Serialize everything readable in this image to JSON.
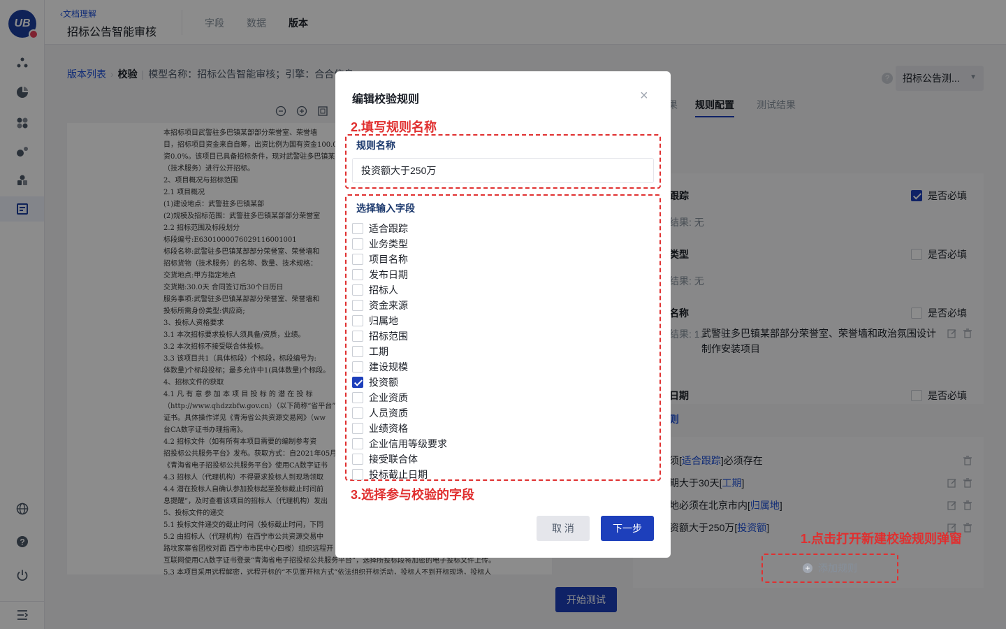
{
  "logo": {
    "text": "UB"
  },
  "header": {
    "back_label": "文档理解",
    "app_title": "招标公告智能审核",
    "tabs": [
      {
        "label": "字段"
      },
      {
        "label": "数据"
      },
      {
        "label": "版本"
      }
    ]
  },
  "breadcrumb": {
    "root": "版本列表",
    "current": "校验",
    "meta": "模型名称：招标公告智能审核；引擎：合合信息"
  },
  "doc_lines": [
    "本招标项目武警驻多巴镇某部部分荣誉室、荣誉墙",
    "目，招标项目资金来自自筹，出资比例为国有资金100.0",
    "资0.0%。该项目已具备招标条件，现对武警驻多巴镇某",
    "（技术服务）进行公开招标。",
    "2、项目概况与招标范围",
    "2.1 项目概况",
    "(1)建设地点：武警驻多巴镇某部",
    "(2)规模及招标范围：武警驻多巴镇某部部分荣誉室",
    "2.2 招标范围及标段划分",
    "标段编号:E6301000076029116001001",
    "标段名称:武警驻多巴镇某部部分荣誉室、荣誉墙和",
    "招标货物（技术服务）的名称、数量、技术规格：",
    "交货地点:甲方指定地点",
    "交货期:30.0天 合同签订后30个日历日",
    "服务事项:武警驻多巴镇某部部分荣誉室、荣誉墙和",
    "投标所需身份类型:供应商;",
    "3、投标人资格要求",
    "3.1 本次招标要求投标人须具备/资质，业绩。",
    "3.2 本次招标不接受联合体投标。",
    "3.3 该项目共1（具体标段）个标段，标段编号为:",
    "体数量)个标段投标；最多允许中1(具体数量)个标段。",
    "4、招标文件的获取",
    "4.1 凡 有 意 参 加 本 项 目 投 标 的 潜 在 投 标",
    "（http://www.qhdzzbfw.gov.cn）（以下简称“省平台”",
    "证书。具体操作详见《青海省公共资源交易网》（ww",
    "台CA数字证书办理指南》。",
    "4.2 招标文件（如有所有本项目需要的编制参考资",
    "招投标公共服务平台》发布。获取方式：自2021年05月",
    "《青海省电子招投标公共服务平台》使用CA数字证书",
    "4.3 招标人（代理机构）不得要求投标人到现场领取",
    "4.4 潜在投标人自确认参加投标起至投标截止时间前",
    "息提醒”，及时查看该项目的招标人（代理机构）发出",
    "5、投标文件的递交",
    "5.1 投标文件递交的截止时间（投标截止时间，下同",
    "5.2 由招标人（代理机构）在西宁市公共资源交易中",
    "路坟家寨省团校对面 西宁市市民中心四楼）组织远程开",
    "互联网使用CA数字证书登录“青海省电子招投标公共服务平台”，选择所投标段将加密的电子投标文件上传。",
    "5.3 本项目采用远程解密，远程开标的“不见面开标方式”依法组织开标活动，投标人不到开标现场，投标人"
  ],
  "start_test_label": "开始测试",
  "right_panel": {
    "help": "?",
    "sample_select": "招标公告测...",
    "tabs": [
      {
        "label": "果"
      },
      {
        "label": "规则配置"
      },
      {
        "label": "测试结果"
      }
    ],
    "fields": [
      {
        "name": "跟踪",
        "required_label": "是否必填",
        "required": true,
        "result_prefix": "结果: 无",
        "result_value": ""
      },
      {
        "name": "类型",
        "required_label": "是否必填",
        "required": false,
        "result_prefix": "结果: 无",
        "result_value": ""
      },
      {
        "name": "名称",
        "required_label": "是否必填",
        "required": false,
        "result_prefix": "结果: 1.",
        "result_value": "武警驻多巴镇某部部分荣誉室、荣誉墙和政治氛围设计制作安装项目"
      },
      {
        "name": "日期",
        "required_label": "是否必填",
        "required": false
      }
    ],
    "rules_heading": "则",
    "rules": [
      {
        "pre": "须[",
        "link": "适合跟踪",
        "post": "]必须存在"
      },
      {
        "pre": "期大于30天[",
        "link": "工期",
        "post": "]"
      },
      {
        "pre": "地必须在北京市内[",
        "link": "归属地",
        "post": "]"
      },
      {
        "pre": "资额大于250万[",
        "link": "投资额",
        "post": "]"
      }
    ],
    "add_rule_label": "添加规则"
  },
  "annotations": {
    "step1": "1.点击打开新建校验规则弹窗",
    "step2": "2.填写规则名称",
    "step3": "3.选择参与校验的字段"
  },
  "modal": {
    "title": "编辑校验规则",
    "close": "×",
    "name_label": "规则名称",
    "name_value": "投资额大于250万",
    "fields_label": "选择输入字段",
    "fields": [
      {
        "label": "适合跟踪",
        "checked": false
      },
      {
        "label": "业务类型",
        "checked": false
      },
      {
        "label": "项目名称",
        "checked": false
      },
      {
        "label": "发布日期",
        "checked": false
      },
      {
        "label": "招标人",
        "checked": false
      },
      {
        "label": "资金来源",
        "checked": false
      },
      {
        "label": "归属地",
        "checked": false
      },
      {
        "label": "招标范围",
        "checked": false
      },
      {
        "label": "工期",
        "checked": false
      },
      {
        "label": "建设规模",
        "checked": false
      },
      {
        "label": "投资额",
        "checked": true
      },
      {
        "label": "企业资质",
        "checked": false
      },
      {
        "label": "人员资质",
        "checked": false
      },
      {
        "label": "业绩资格",
        "checked": false
      },
      {
        "label": "企业信用等级要求",
        "checked": false
      },
      {
        "label": "接受联合体",
        "checked": false
      },
      {
        "label": "投标截止日期",
        "checked": false
      }
    ],
    "cancel_label": "取 消",
    "next_label": "下一步"
  },
  "colors": {
    "primary": "#1d3fbb",
    "link": "#1d4fd8",
    "annotation": "#e02f2f"
  }
}
